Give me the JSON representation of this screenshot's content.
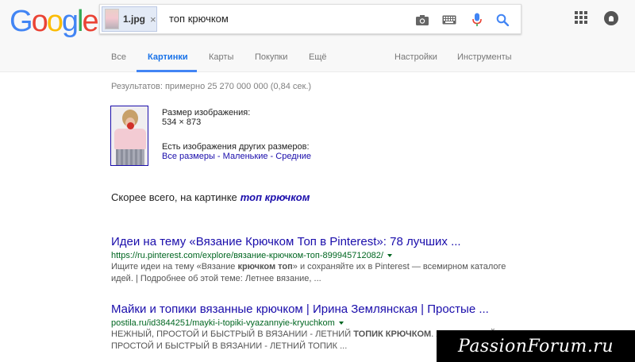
{
  "header": {
    "logo": [
      "G",
      "o",
      "o",
      "g",
      "l",
      "e"
    ],
    "logo_colors": [
      "#4285F4",
      "#EA4335",
      "#FBBC05",
      "#4285F4",
      "#34A853",
      "#EA4335"
    ],
    "image_chip": {
      "filename": "1.jpg",
      "remove": "×"
    },
    "query": "топ крючком",
    "icons": [
      "camera-icon",
      "keyboard-icon",
      "mic-icon",
      "search-icon",
      "apps-icon",
      "notifications-icon"
    ]
  },
  "tabs": {
    "all": "Все",
    "images": "Картинки",
    "maps": "Карты",
    "shopping": "Покупки",
    "more": "Ещё",
    "settings": "Настройки",
    "tools": "Инструменты"
  },
  "stats": "Результатов: примерно 25 270 000 000 (0,84 сек.)",
  "image_info": {
    "size_label": "Размер изображения:",
    "size_value": "534 × 873",
    "other_sizes_label": "Есть изображения других размеров:",
    "all_sizes": "Все размеры",
    "small": "Маленькие",
    "medium": "Средние",
    "separator": " - "
  },
  "best_guess": {
    "label": "Скорее всего, на картинке",
    "link": "топ крючком"
  },
  "results": [
    {
      "title": "Идеи на тему «Вязание Крючком Топ в Pinterest»: 78 лучших ...",
      "url": "https://ru.pinterest.com/explore/вязание-крючком-топ-899945712082/",
      "snippet_1": "Ищите идеи на тему «Вязание ",
      "snippet_bold": "крючком топ",
      "snippet_2": "» и сохраняйте их в Pinterest — всемирном каталоге идей. | Подробнее об этой теме: Летнее вязание, ..."
    },
    {
      "title": "Майки и топики вязанные крючком | Ирина Землянская | Простые ...",
      "url": "postila.ru/id3844251/mayki-i-topiki-vyazannyie-kryuchkom",
      "snippet_1": "НЕЖНЫЙ, ПРОСТОЙ И БЫСТРЫЙ В ВЯЗАНИИ - ЛЕТНИЙ ",
      "snippet_bold": "ТОПИК КРЮЧКОМ",
      "snippet_2": ". 2: 4. НЕЖНЫЙ, ПРОСТОЙ И БЫСТРЫЙ В ВЯЗАНИИ - ЛЕТНИЙ ТОПИК ..."
    }
  ],
  "watermark": "PassionForum.ru",
  "colors": {
    "link": "#1a0dab",
    "url": "#006621",
    "accent_tab": "#4285f4",
    "mic_blue": "#4285f4",
    "mic_red": "#ea4335"
  }
}
